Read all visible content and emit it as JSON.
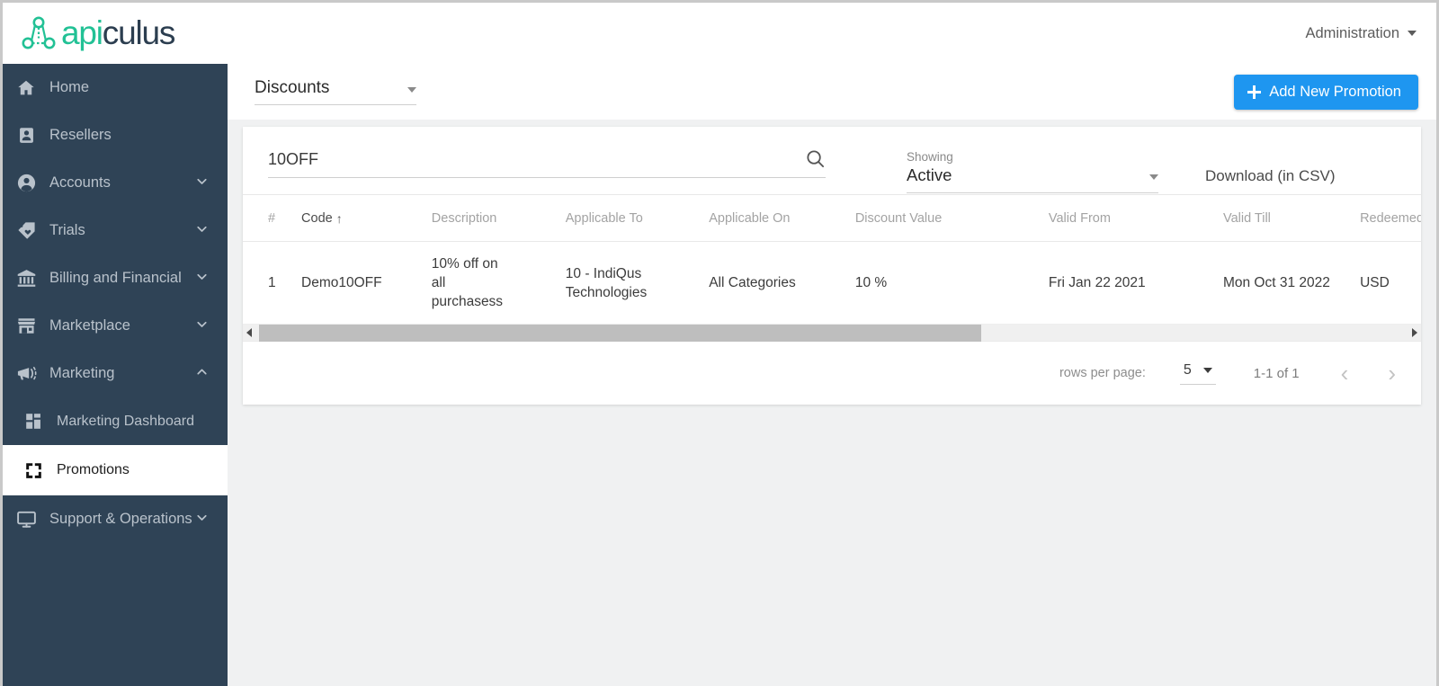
{
  "brand": {
    "name_part1": "api",
    "name_part2": "culus",
    "accent_color": "#22c195",
    "dark_color": "#2c3e50"
  },
  "topbar": {
    "account_label": "Administration"
  },
  "sidebar": {
    "bg_color": "#2f4356",
    "items": [
      {
        "label": "Home",
        "icon": "home-icon",
        "expandable": false,
        "active": false
      },
      {
        "label": "Resellers",
        "icon": "id-card-icon",
        "expandable": false,
        "active": false
      },
      {
        "label": "Accounts",
        "icon": "user-circle-icon",
        "expandable": true,
        "expanded": false,
        "active": false
      },
      {
        "label": "Trials",
        "icon": "tag-heart-icon",
        "expandable": true,
        "expanded": false,
        "active": false
      },
      {
        "label": "Billing and Financial",
        "icon": "bank-icon",
        "expandable": true,
        "expanded": false,
        "active": false
      },
      {
        "label": "Marketplace",
        "icon": "storefront-icon",
        "expandable": true,
        "expanded": false,
        "active": false
      },
      {
        "label": "Marketing",
        "icon": "megaphone-icon",
        "expandable": true,
        "expanded": true,
        "active": false
      },
      {
        "label": "Marketing Dashboard",
        "icon": "dashboard-grid-icon",
        "expandable": false,
        "active": false,
        "sub": true
      },
      {
        "label": "Promotions",
        "icon": "expand-corners-icon",
        "expandable": false,
        "active": true,
        "sub": true
      },
      {
        "label": "Support & Operations",
        "icon": "monitor-icon",
        "expandable": true,
        "expanded": false,
        "active": false
      }
    ]
  },
  "toolbar": {
    "type_select_value": "Discounts",
    "add_button_label": "Add New Promotion",
    "add_button_color": "#1e96f0"
  },
  "filters": {
    "search_value": "10OFF",
    "search_placeholder": "Search",
    "showing_label": "Showing",
    "showing_value": "Active",
    "download_label": "Download (in CSV)"
  },
  "table": {
    "columns": [
      {
        "key": "num",
        "label": "#",
        "sorted": false
      },
      {
        "key": "code",
        "label": "Code",
        "sorted": true,
        "sort_dir": "asc",
        "sort_glyph": "↑"
      },
      {
        "key": "description",
        "label": "Description",
        "sorted": false
      },
      {
        "key": "applicable_to",
        "label": "Applicable To",
        "sorted": false
      },
      {
        "key": "applicable_on",
        "label": "Applicable On",
        "sorted": false
      },
      {
        "key": "discount_value",
        "label": "Discount Value",
        "sorted": false
      },
      {
        "key": "valid_from",
        "label": "Valid From",
        "sorted": false
      },
      {
        "key": "valid_till",
        "label": "Valid Till",
        "sorted": false
      },
      {
        "key": "redeemed",
        "label": "Redeemed",
        "sorted": false
      }
    ],
    "rows": [
      {
        "num": "1",
        "code": "Demo10OFF",
        "description": "10% off on all purchasess",
        "applicable_to": "10 - IndiQus Technologies",
        "applicable_on": "All Categories",
        "discount_value": "10 %",
        "valid_from": "Fri Jan 22 2021",
        "valid_till": "Mon Oct 31 2022",
        "redeemed": "USD"
      }
    ]
  },
  "pagination": {
    "rows_per_page_label": "rows per page:",
    "rows_per_page_value": "5",
    "range_label": "1-1 of 1",
    "prev_glyph": "‹",
    "next_glyph": "›"
  }
}
